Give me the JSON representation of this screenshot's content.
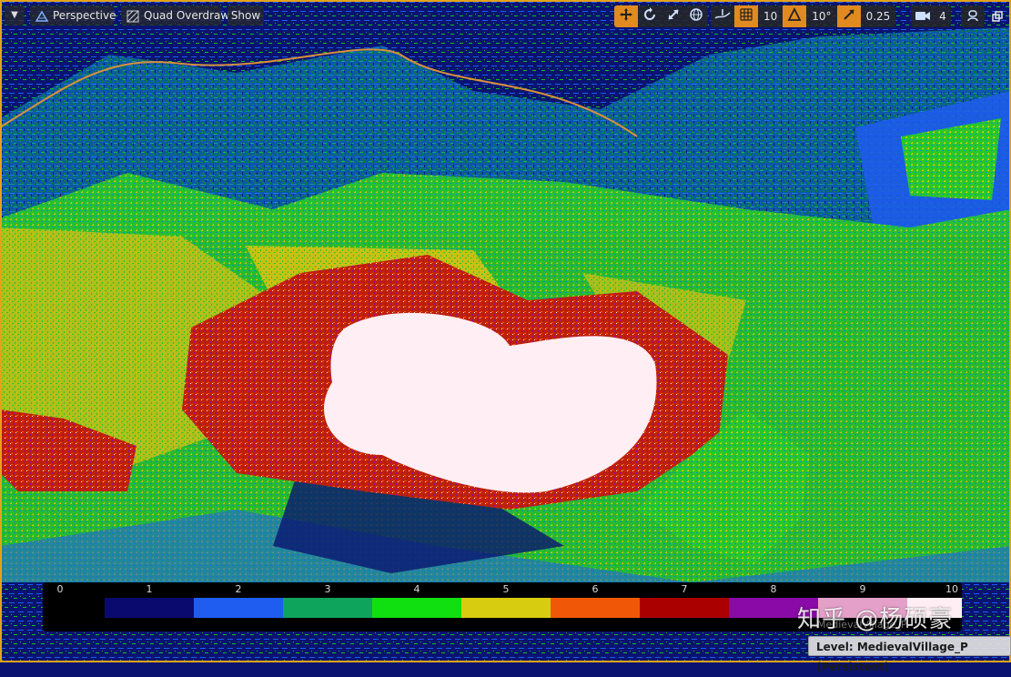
{
  "viewport": {
    "mode_label": "Perspective",
    "view_mode_label": "Quad Overdraw",
    "show_label": "Show"
  },
  "toolbar_right": {
    "grid_snap_value": "10",
    "rotation_snap_value": "10°",
    "scale_snap_value": "0.25",
    "camera_speed_value": "4"
  },
  "legend": {
    "ticks": [
      "0",
      "1",
      "2",
      "3",
      "4",
      "5",
      "6",
      "7",
      "8",
      "9",
      "10"
    ],
    "colors": [
      "#000000",
      "#0a0a6e",
      "#1f5cf0",
      "#0fa45c",
      "#10e010",
      "#d8cc10",
      "#f05808",
      "#aa0000",
      "#8a0aa8",
      "#e4a0c8",
      "#ffeef4"
    ]
  },
  "watermark": "知乎 @杨硕豪",
  "ghost_text": "MedievalVillage_P",
  "status": {
    "level_text": "Level:  MedievalVillage_P (Persistent)"
  },
  "icons": [
    "dropdown-arrow-icon",
    "perspective-icon",
    "quad-overdraw-icon",
    "move-icon",
    "rotate-icon",
    "scale-icon",
    "world-globe-icon",
    "surface-snap-icon",
    "grid-snap-icon",
    "rotation-snap-icon",
    "scale-snap-icon",
    "camera-speed-icon",
    "maximize-icon",
    "restore-window-icon"
  ]
}
